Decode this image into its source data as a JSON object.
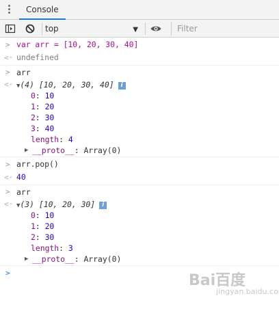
{
  "tabs": {
    "console": "Console"
  },
  "toolbar": {
    "context": "top",
    "filter_placeholder": "Filter"
  },
  "console": {
    "cmd1": {
      "code": "var arr = [10, 20, 30, 40]",
      "result": "undefined"
    },
    "cmd2": {
      "code": "arr",
      "summary_count": "(4)",
      "summary_values": "[10, 20, 30, 40]",
      "items": [
        {
          "key": "0",
          "value": "10"
        },
        {
          "key": "1",
          "value": "20"
        },
        {
          "key": "2",
          "value": "30"
        },
        {
          "key": "3",
          "value": "40"
        }
      ],
      "length_key": "length",
      "length_value": "4",
      "proto_key": "__proto__",
      "proto_value": "Array(0)"
    },
    "cmd3": {
      "code": "arr.pop()",
      "result": "40"
    },
    "cmd4": {
      "code": "arr",
      "summary_count": "(3)",
      "summary_values": "[10, 20, 30]",
      "items": [
        {
          "key": "0",
          "value": "10"
        },
        {
          "key": "1",
          "value": "20"
        },
        {
          "key": "2",
          "value": "30"
        }
      ],
      "length_key": "length",
      "length_value": "3",
      "proto_key": "__proto__",
      "proto_value": "Array(0)"
    }
  },
  "watermark": {
    "logo": "Bai百度",
    "url": "jingyan.baidu.com"
  },
  "icons": {
    "menu": "kebab-menu-icon",
    "sidebar": "sidebar-toggle-icon",
    "clear": "clear-console-icon",
    "eye": "eye-icon",
    "info": "info-icon"
  }
}
